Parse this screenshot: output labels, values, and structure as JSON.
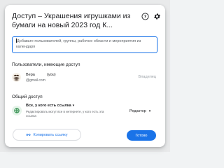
{
  "dialog": {
    "title": "Доступ – Украшения игрушками из бумаги на новый 2023 год К...",
    "add_placeholder": "Добавьте пользователей, группы, рабочие области и мероприятия из календаря"
  },
  "users_section": {
    "title": "Пользователи, имеющие доступ",
    "users": [
      {
        "name": "Вера",
        "you_label": "(you)",
        "email": "@gmail.com",
        "role": "Владелец"
      }
    ]
  },
  "general_access": {
    "title": "Общий доступ",
    "selected": "Все, у кого есть ссылка",
    "description": "Редактировать могут все в интернете, у кого есть эта ссылка",
    "role": "Редактор"
  },
  "footer": {
    "copy_link_label": "Копировать ссылку",
    "done_label": "Готово"
  },
  "colors": {
    "accent": "#1a73e8",
    "text": "#202124",
    "muted": "#5f6368",
    "globe_bg": "#e6f4ea",
    "globe_fg": "#188038"
  },
  "icons": [
    "help-icon",
    "gear-icon",
    "globe-icon",
    "link-icon",
    "chevron-down-icon"
  ]
}
